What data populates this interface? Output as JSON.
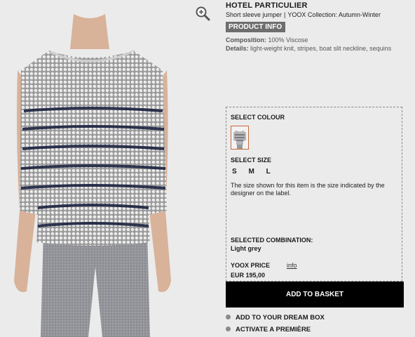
{
  "product": {
    "brand": "HOTEL PARTICULIER",
    "category": "Short sleeve jumper",
    "separator": "|",
    "collection": "YOOX Collection: Autumn-Winter",
    "info_badge": "PRODUCT INFO",
    "composition_label": "Composition:",
    "composition_value": "100% Viscose",
    "details_label": "Details:",
    "details_value": "light-weight knit, stripes, boat slit neckline, sequins"
  },
  "panel": {
    "select_colour": "SELECT COLOUR",
    "select_size": "SELECT SIZE",
    "sizes": [
      "S",
      "M",
      "L"
    ],
    "size_note": "The size shown for this item is the size indicated by the designer on the label.",
    "selected_combination_label": "SELECTED COMBINATION:",
    "selected_combination_value": "Light grey",
    "price_label": "YOOX PRICE",
    "info_link": "info",
    "price": "EUR 195,00"
  },
  "actions": {
    "add_to_basket": "ADD TO BASKET",
    "dream_box": "ADD TO YOUR DREAM BOX",
    "premiere": "ACTIVATE A PREMIÈRE"
  },
  "colors": {
    "background": "#ebebeb",
    "badge": "#6e6e6e",
    "button": "#000000",
    "swatch_border": "#c86a3a",
    "stripe": "#1c2340"
  },
  "icons": {
    "zoom": "zoom-in-icon",
    "bullet": "bullet-dot-icon"
  }
}
